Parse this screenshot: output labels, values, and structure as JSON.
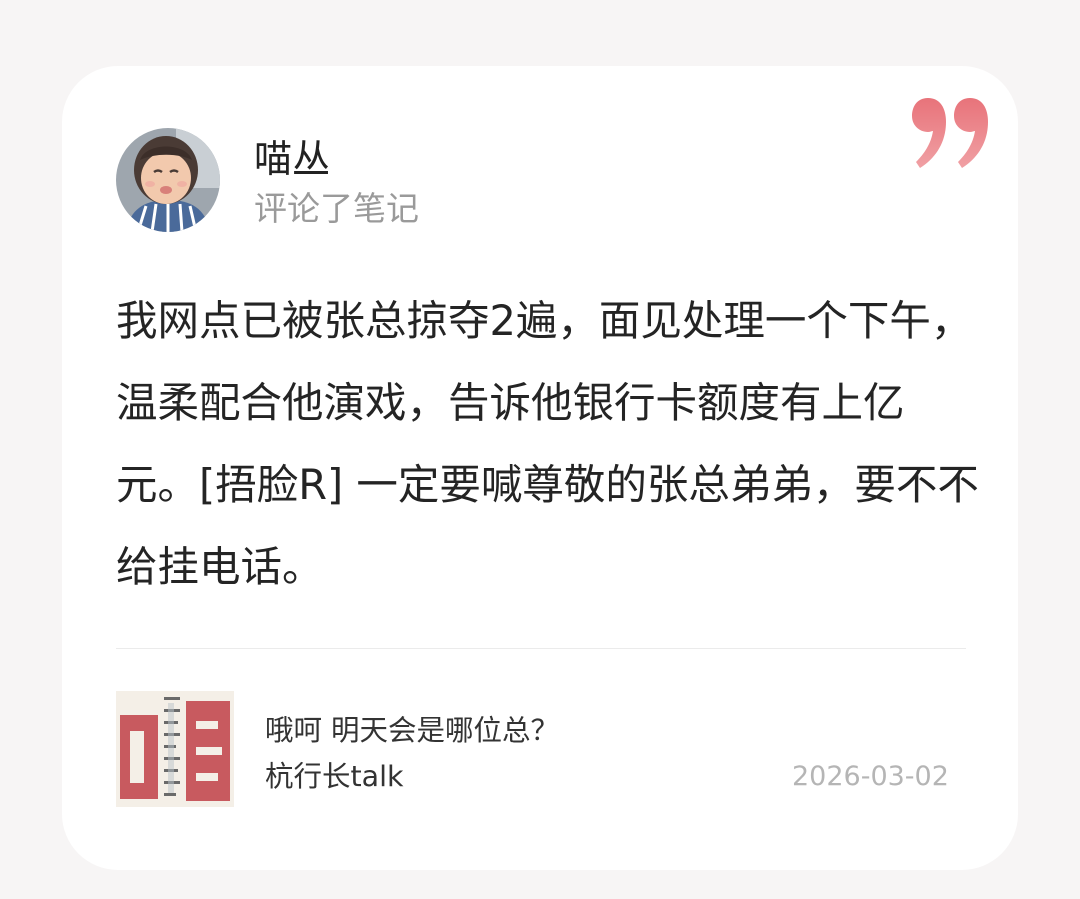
{
  "header": {
    "username": "喵丛",
    "action": "评论了笔记"
  },
  "comment": {
    "text": "我网点已被张总掠夺2遍，面见处理一个下午，温柔配合他演戏，告诉他银行卡额度有上亿元。[捂脸R] 一定要喊尊敬的张总弟弟，要不不给挂电话。"
  },
  "note": {
    "title": "哦呵 明天会是哪位总？",
    "author": "杭行长talk",
    "date": "2026-03-02",
    "cover_icon": "collage-thumbnail"
  },
  "icons": {
    "quote": "quote-icon",
    "avatar": "avatar"
  },
  "colors": {
    "quote_accent": "#e8737a",
    "cover_red": "#c85a5f",
    "background": "#f7f5f5",
    "card": "#ffffff"
  }
}
